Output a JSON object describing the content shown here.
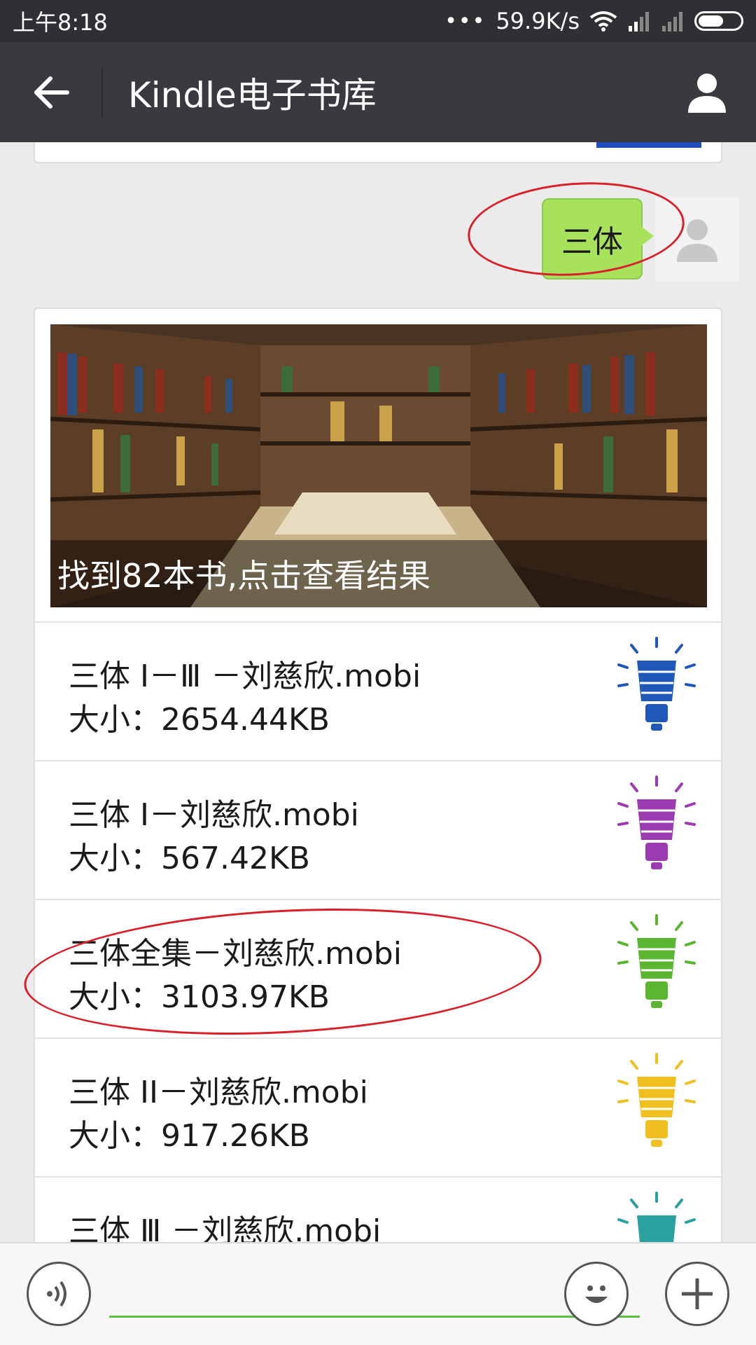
{
  "status_bar": {
    "time": "上午8:18",
    "dots": "•••",
    "speed": "59.9K/s",
    "icons": [
      "wifi-icon",
      "signal-icon",
      "signal-icon",
      "battery-icon"
    ]
  },
  "header": {
    "back_icon": "arrow-left-icon",
    "title": "Kindle电子书库",
    "profile_icon": "person-icon"
  },
  "chat": {
    "my_message": {
      "text": "三体",
      "bubble_color": "#a8e25d"
    },
    "result_card": {
      "banner_caption": "找到82本书,点击查看结果",
      "books": [
        {
          "name": "三体 Ⅰ－Ⅲ －刘慈欣.mobi",
          "size": "大小：2654.44KB",
          "bulb_color": "#1f58b8"
        },
        {
          "name": "三体 I－刘慈欣.mobi",
          "size": "大小：567.42KB",
          "bulb_color": "#9b3bb0"
        },
        {
          "name": "三体全集－刘慈欣.mobi",
          "size": "大小：3103.97KB",
          "bulb_color": "#5bb531"
        },
        {
          "name": "三体 II－刘慈欣.mobi",
          "size": "大小：917.26KB",
          "bulb_color": "#f0c020"
        },
        {
          "name": "三体 Ⅲ －刘慈欣.mobi",
          "size": "",
          "bulb_color": "#2aa0a0"
        }
      ]
    }
  },
  "input_bar": {
    "voice_icon": "voice-icon",
    "emoji_icon": "emoji-icon",
    "plus_icon": "plus-icon",
    "accent_color": "#5cbf40"
  },
  "annotation_color": "#d8202a"
}
